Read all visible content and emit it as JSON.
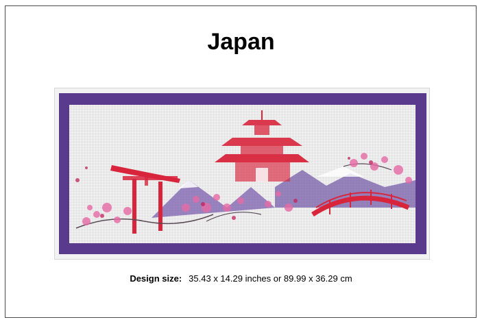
{
  "design": {
    "title": "Japan",
    "size_label": "Design size:",
    "size_value": "35.43 x 14.29 inches or 89.99 x 36.29 cm"
  },
  "colors": {
    "border_purple": "#5a3a8c",
    "canvas_grey": "#e6e6e6",
    "torii_red": "#d8253c",
    "blossom_pink": "#e76aa5",
    "mountain_purple": "#5b3b99"
  },
  "artwork_elements": [
    "torii-gate",
    "pagoda",
    "mountains",
    "cherry-blossom-branches",
    "arched-bridge"
  ]
}
